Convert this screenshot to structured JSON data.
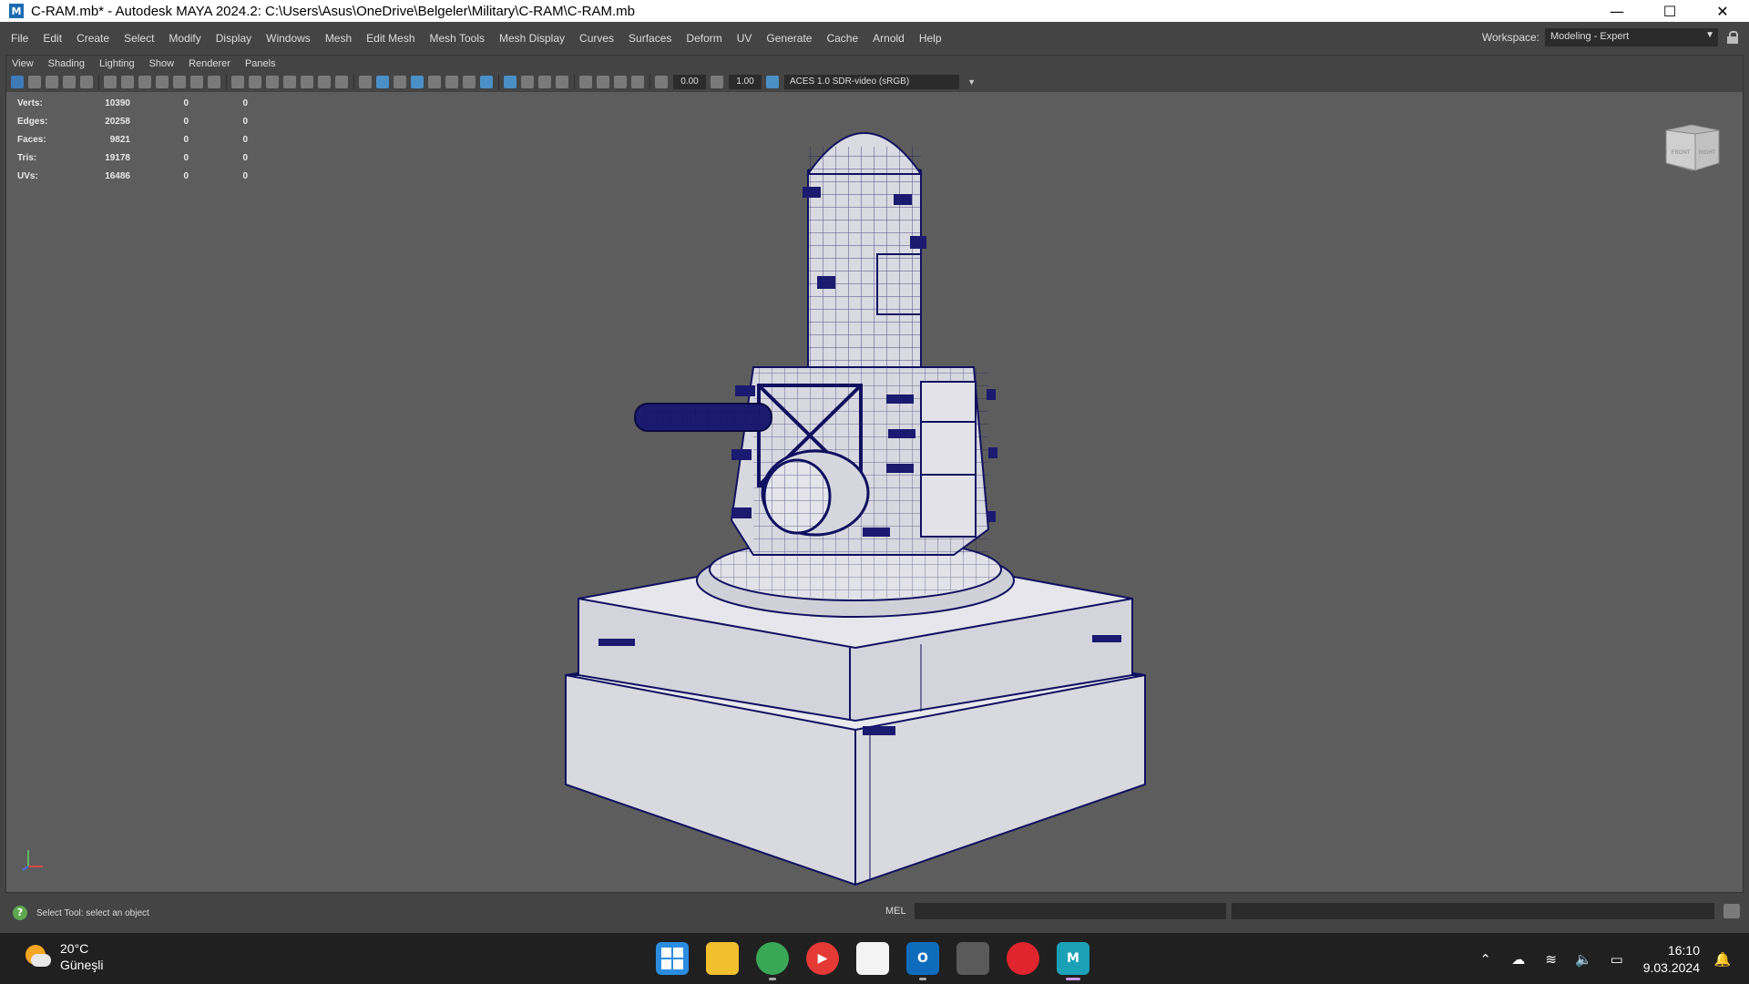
{
  "window": {
    "title": "C-RAM.mb* - Autodesk MAYA 2024.2: C:\\Users\\Asus\\OneDrive\\Belgeler\\Military\\C-RAM\\C-RAM.mb",
    "app_icon_letter": "M",
    "minimize_glyph": "—",
    "maximize_glyph": "☐",
    "close_glyph": "✕"
  },
  "menubar": {
    "items": [
      "File",
      "Edit",
      "Create",
      "Select",
      "Modify",
      "Display",
      "Windows",
      "Mesh",
      "Edit Mesh",
      "Mesh Tools",
      "Mesh Display",
      "Curves",
      "Surfaces",
      "Deform",
      "UV",
      "Generate",
      "Cache",
      "Arnold",
      "Help"
    ],
    "workspace_label": "Workspace:",
    "workspace_value": "Modeling - Expert"
  },
  "panel": {
    "menu": [
      "View",
      "Shading",
      "Lighting",
      "Show",
      "Renderer",
      "Panels"
    ],
    "toolbar": {
      "exposure": "0.00",
      "gamma": "1.00",
      "color_management": "ACES 1.0 SDR-video (sRGB)"
    }
  },
  "hud": {
    "rows": [
      {
        "label": "Verts:",
        "values": [
          "10390",
          "0",
          "0"
        ]
      },
      {
        "label": "Edges:",
        "values": [
          "20258",
          "0",
          "0"
        ]
      },
      {
        "label": "Faces:",
        "values": [
          "9821",
          "0",
          "0"
        ]
      },
      {
        "label": "Tris:",
        "values": [
          "19178",
          "0",
          "0"
        ]
      },
      {
        "label": "UVs:",
        "values": [
          "16486",
          "0",
          "0"
        ]
      }
    ]
  },
  "viewcube": {
    "front": "FRONT",
    "right": "RIGHT"
  },
  "status": {
    "help_text": "Select Tool: select an object",
    "help_icon": "?",
    "command_language": "MEL"
  },
  "taskbar": {
    "weather_temp": "20°C",
    "weather_desc": "Güneşli",
    "time": "16:10",
    "date": "9.03.2024",
    "apps": [
      {
        "name": "windows-start",
        "glyph": "",
        "color": "#2b8de0"
      },
      {
        "name": "file-explorer",
        "glyph": "",
        "color": "#f2c02e"
      },
      {
        "name": "chrome",
        "glyph": "",
        "color": "#3aa757"
      },
      {
        "name": "youtube",
        "glyph": "▶",
        "color": "#e53935"
      },
      {
        "name": "microsoft-store",
        "glyph": "",
        "color": "#f3f3f3"
      },
      {
        "name": "outlook",
        "glyph": "O",
        "color": "#0f6cbd"
      },
      {
        "name": "unity",
        "glyph": "",
        "color": "#5a5a5a"
      },
      {
        "name": "app-red",
        "glyph": "",
        "color": "#e1252e"
      },
      {
        "name": "maya",
        "glyph": "M",
        "color": "#1ba1b6"
      }
    ],
    "tray": {
      "chevron": "⌃",
      "cloud": "☁",
      "wifi": "≋",
      "volume": "🔈",
      "battery": "▭",
      "bell": "🔔"
    }
  }
}
